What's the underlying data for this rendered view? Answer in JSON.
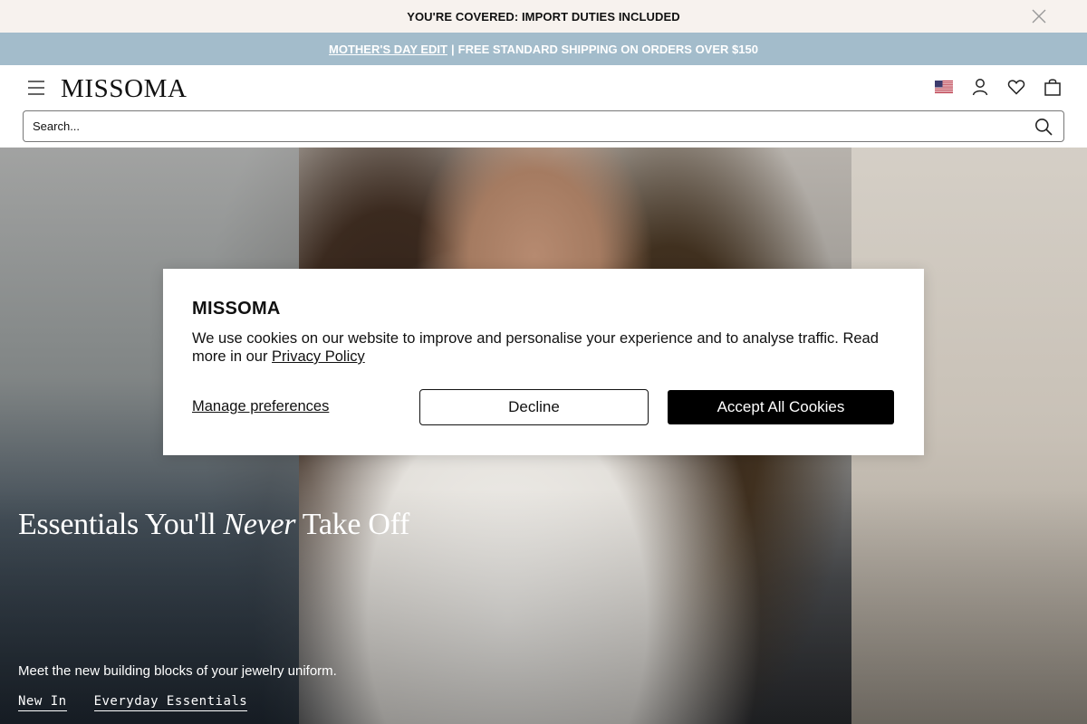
{
  "announcement": {
    "text": "YOU'RE COVERED: IMPORT DUTIES INCLUDED",
    "close_icon": "close-icon"
  },
  "promo": {
    "link_label": "MOTHER'S DAY EDIT",
    "separator": "|",
    "text": "FREE STANDARD SHIPPING ON ORDERS OVER $150"
  },
  "header": {
    "logo": "MISSOMA",
    "icons": [
      "menu-icon",
      "us-flag-icon",
      "account-icon",
      "heart-icon",
      "bag-icon"
    ]
  },
  "search": {
    "placeholder": "Search...",
    "icon": "search-icon"
  },
  "hero": {
    "headline_before": "Essentials You'll ",
    "headline_emphasis": "Never",
    "headline_after": " Take Off",
    "subtext": "Meet the new building blocks of your jewelry uniform.",
    "links": [
      "New In",
      "Everyday Essentials"
    ]
  },
  "cookie_banner": {
    "brand": "MISSOMA",
    "message": "We use cookies on our website to improve and personalise your experience and to analyse traffic. Read more in our ",
    "privacy_link": "Privacy Policy",
    "manage_label": "Manage preferences",
    "decline_label": "Decline",
    "accept_label": "Accept All Cookies"
  },
  "colors": {
    "announcement_bg": "#f7f2ee",
    "promo_bg": "#a3bccb",
    "accept_bg": "#000000"
  }
}
